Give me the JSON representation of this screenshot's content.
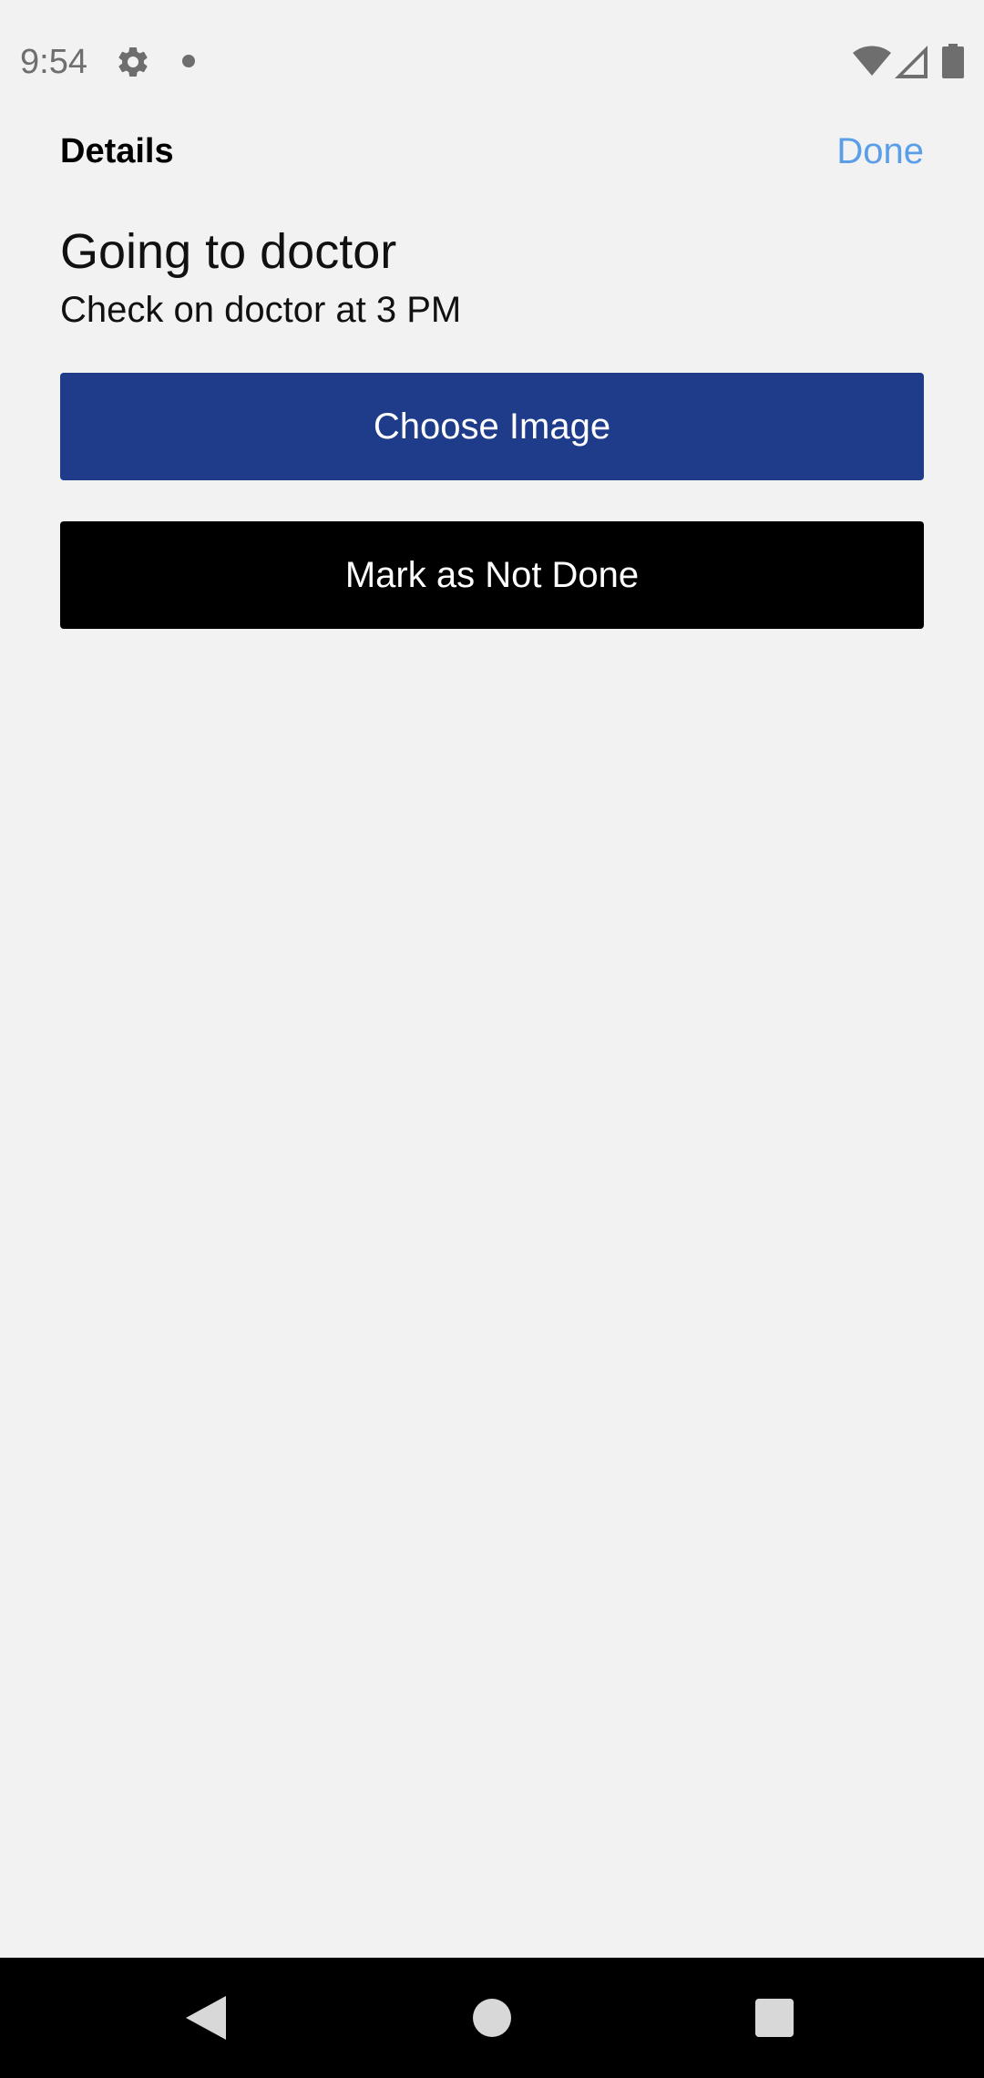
{
  "status_bar": {
    "time": "9:54",
    "icons": [
      "gear-icon",
      "notification-dot-icon",
      "wifi-icon",
      "cell-signal-icon",
      "battery-icon"
    ]
  },
  "header": {
    "title": "Details",
    "done_label": "Done"
  },
  "task": {
    "title": "Going to doctor",
    "description": "Check on doctor at 3 PM"
  },
  "actions": {
    "choose_image_label": "Choose Image",
    "mark_not_done_label": "Mark as Not Done"
  },
  "nav_bar": {
    "icons": [
      "back-icon",
      "home-icon",
      "recents-icon"
    ]
  },
  "colors": {
    "background": "#f2f2f2",
    "accent_link": "#5a9ee8",
    "primary_button": "#1f3c8a",
    "secondary_button": "#000000"
  }
}
